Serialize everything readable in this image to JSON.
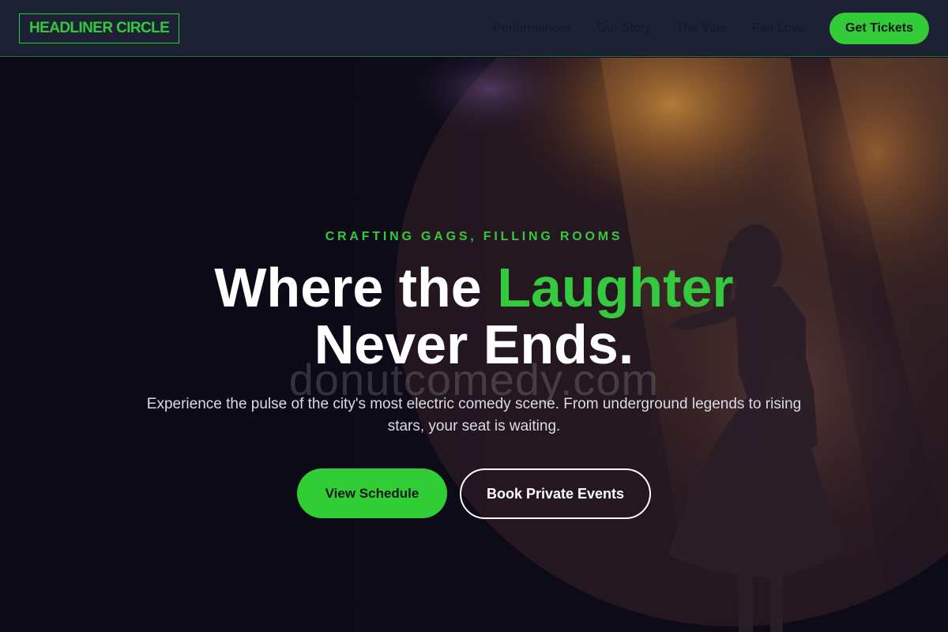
{
  "brand": {
    "name": "HEADLINER CIRCLE",
    "accent_color": "#34c93f"
  },
  "nav": {
    "links": [
      "Performances",
      "Our Story",
      "The Vibe",
      "Fan Love"
    ],
    "cta_label": "Get Tickets"
  },
  "hero": {
    "eyebrow": "CRAFTING GAGS, FILLING ROOMS",
    "headline_part1": "Where the ",
    "headline_accent": "Laughter",
    "headline_part2": "Never Ends.",
    "watermark": "donutcomedy.com",
    "subtitle": "Experience the pulse of the city's most electric comedy scene. From underground legends to rising stars, your seat is waiting.",
    "primary_button": "View Schedule",
    "secondary_button": "Book Private Events",
    "background_image": "performer-silhouette-on-stage-spotlight"
  }
}
